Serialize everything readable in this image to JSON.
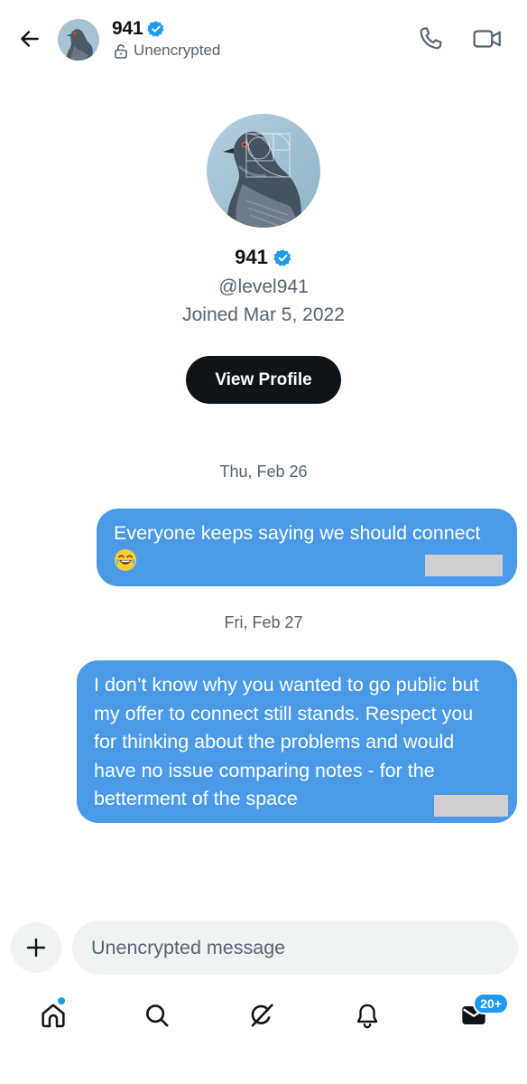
{
  "header": {
    "name": "941",
    "encryption_status": "Unencrypted",
    "icons": {
      "back": "back-arrow-icon",
      "verified": "verified-badge-icon",
      "lock": "unlocked-padlock-icon",
      "call": "phone-icon",
      "video": "video-camera-icon"
    }
  },
  "profile": {
    "name": "941",
    "handle": "@level941",
    "joined": "Joined Mar 5, 2022",
    "view_profile_label": "View Profile"
  },
  "messages": [
    {
      "date": "Thu, Feb 26",
      "text": "Everyone keeps saying we should connect",
      "emoji": "😂",
      "sender": "self",
      "timestamp_redacted": true
    },
    {
      "date": "Fri, Feb 27",
      "text": "I don’t know why you wanted to go public but my offer to connect still stands. Respect you for thinking about the problems and would have no issue comparing notes - for the betterment of the space",
      "sender": "self",
      "timestamp_redacted": true
    }
  ],
  "composer": {
    "placeholder": "Unencrypted message",
    "add_icon": "plus-icon"
  },
  "nav": {
    "items": [
      "home-icon",
      "search-icon",
      "grok-icon",
      "notifications-bell-icon",
      "messages-envelope-icon"
    ],
    "messages_badge": "20+"
  },
  "colors": {
    "bubble": "#4a9ae8",
    "accent": "#1d9bf0",
    "text_primary": "#0f1419",
    "text_secondary": "#536471",
    "button_dark": "#0f1419"
  }
}
